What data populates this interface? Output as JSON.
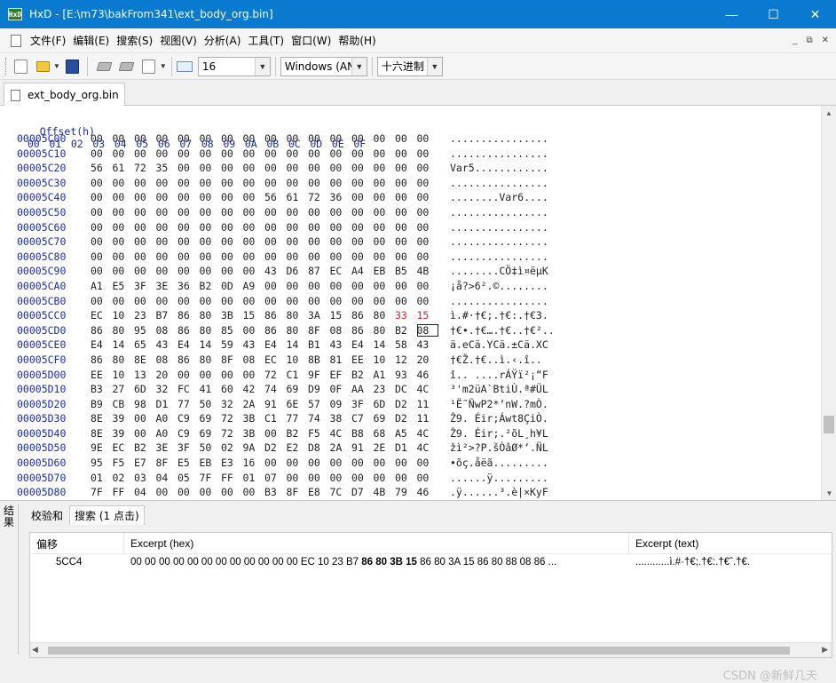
{
  "window": {
    "app_icon_text": "HxD",
    "title": "HxD - [E:\\m73\\bakFrom341\\ext_body_org.bin]",
    "minimize": "—",
    "maximize": "☐",
    "close": "✕"
  },
  "menu": {
    "items": [
      "文件(F)",
      "编辑(E)",
      "搜索(S)",
      "视图(V)",
      "分析(A)",
      "工具(T)",
      "窗口(W)",
      "帮助(H)"
    ],
    "mdi": [
      "_",
      "⧉",
      "✕"
    ]
  },
  "toolbar": {
    "bytes_per_row": "16",
    "charset": "Windows (ANSI)",
    "offset_base": "十六进制"
  },
  "file_tab": {
    "label": "ext_body_org.bin"
  },
  "hex": {
    "header_offset": "Offset(h)",
    "header_cols": [
      "00",
      "01",
      "02",
      "03",
      "04",
      "05",
      "06",
      "07",
      "08",
      "09",
      "0A",
      "0B",
      "0C",
      "0D",
      "0E",
      "0F"
    ],
    "rows": [
      {
        "offset": "00005C00",
        "bytes": [
          "00",
          "00",
          "00",
          "00",
          "00",
          "00",
          "00",
          "00",
          "00",
          "00",
          "00",
          "00",
          "00",
          "00",
          "00",
          "00"
        ],
        "text": "................"
      },
      {
        "offset": "00005C10",
        "bytes": [
          "00",
          "00",
          "00",
          "00",
          "00",
          "00",
          "00",
          "00",
          "00",
          "00",
          "00",
          "00",
          "00",
          "00",
          "00",
          "00"
        ],
        "text": "................"
      },
      {
        "offset": "00005C20",
        "bytes": [
          "56",
          "61",
          "72",
          "35",
          "00",
          "00",
          "00",
          "00",
          "00",
          "00",
          "00",
          "00",
          "00",
          "00",
          "00",
          "00"
        ],
        "text": "Var5............"
      },
      {
        "offset": "00005C30",
        "bytes": [
          "00",
          "00",
          "00",
          "00",
          "00",
          "00",
          "00",
          "00",
          "00",
          "00",
          "00",
          "00",
          "00",
          "00",
          "00",
          "00"
        ],
        "text": "................"
      },
      {
        "offset": "00005C40",
        "bytes": [
          "00",
          "00",
          "00",
          "00",
          "00",
          "00",
          "00",
          "00",
          "56",
          "61",
          "72",
          "36",
          "00",
          "00",
          "00",
          "00"
        ],
        "text": "........Var6...."
      },
      {
        "offset": "00005C50",
        "bytes": [
          "00",
          "00",
          "00",
          "00",
          "00",
          "00",
          "00",
          "00",
          "00",
          "00",
          "00",
          "00",
          "00",
          "00",
          "00",
          "00"
        ],
        "text": "................"
      },
      {
        "offset": "00005C60",
        "bytes": [
          "00",
          "00",
          "00",
          "00",
          "00",
          "00",
          "00",
          "00",
          "00",
          "00",
          "00",
          "00",
          "00",
          "00",
          "00",
          "00"
        ],
        "text": "................"
      },
      {
        "offset": "00005C70",
        "bytes": [
          "00",
          "00",
          "00",
          "00",
          "00",
          "00",
          "00",
          "00",
          "00",
          "00",
          "00",
          "00",
          "00",
          "00",
          "00",
          "00"
        ],
        "text": "................"
      },
      {
        "offset": "00005C80",
        "bytes": [
          "00",
          "00",
          "00",
          "00",
          "00",
          "00",
          "00",
          "00",
          "00",
          "00",
          "00",
          "00",
          "00",
          "00",
          "00",
          "00"
        ],
        "text": "................"
      },
      {
        "offset": "00005C90",
        "bytes": [
          "00",
          "00",
          "00",
          "00",
          "00",
          "00",
          "00",
          "00",
          "43",
          "D6",
          "87",
          "EC",
          "A4",
          "EB",
          "B5",
          "4B"
        ],
        "text": "........CÖ‡ì¤ëµK"
      },
      {
        "offset": "00005CA0",
        "bytes": [
          "A1",
          "E5",
          "3F",
          "3E",
          "36",
          "B2",
          "0D",
          "A9",
          "00",
          "00",
          "00",
          "00",
          "00",
          "00",
          "00",
          "00"
        ],
        "text": "¡å?>6².©........"
      },
      {
        "offset": "00005CB0",
        "bytes": [
          "00",
          "00",
          "00",
          "00",
          "00",
          "00",
          "00",
          "00",
          "00",
          "00",
          "00",
          "00",
          "00",
          "00",
          "00",
          "00"
        ],
        "text": "................"
      },
      {
        "offset": "00005CC0",
        "bytes": [
          "EC",
          "10",
          "23",
          "B7",
          "86",
          "80",
          "3B",
          "15",
          "86",
          "80",
          "3A",
          "15",
          "86",
          "80",
          "33",
          "15"
        ],
        "text": "ì.#·†€;.†€:.†€3."
      },
      {
        "offset": "00005CD0",
        "bytes": [
          "86",
          "80",
          "95",
          "08",
          "86",
          "80",
          "85",
          "00",
          "86",
          "80",
          "8F",
          "08",
          "86",
          "80",
          "B2",
          "08"
        ],
        "text": "†€•.†€….†€..†€².."
      },
      {
        "offset": "00005CE0",
        "bytes": [
          "E4",
          "14",
          "65",
          "43",
          "E4",
          "14",
          "59",
          "43",
          "E4",
          "14",
          "B1",
          "43",
          "E4",
          "14",
          "58",
          "43"
        ],
        "text": "ä.eCä.YCä.±Cä.XC"
      },
      {
        "offset": "00005CF0",
        "bytes": [
          "86",
          "80",
          "8E",
          "08",
          "86",
          "80",
          "8F",
          "08",
          "EC",
          "10",
          "8B",
          "81",
          "EE",
          "10",
          "12",
          "20"
        ],
        "text": "†€Ž.†€..ì.‹.î.. "
      },
      {
        "offset": "00005D00",
        "bytes": [
          "EE",
          "10",
          "13",
          "20",
          "00",
          "00",
          "00",
          "00",
          "72",
          "C1",
          "9F",
          "EF",
          "B2",
          "A1",
          "93",
          "46"
        ],
        "text": "î.. ....rÁŸï²¡“F"
      },
      {
        "offset": "00005D10",
        "bytes": [
          "B3",
          "27",
          "6D",
          "32",
          "FC",
          "41",
          "60",
          "42",
          "74",
          "69",
          "D9",
          "0F",
          "AA",
          "23",
          "DC",
          "4C"
        ],
        "text": "³'m2üA`BtiÙ.ª#ÜL"
      },
      {
        "offset": "00005D20",
        "bytes": [
          "B9",
          "CB",
          "98",
          "D1",
          "77",
          "50",
          "32",
          "2A",
          "91",
          "6E",
          "57",
          "09",
          "3F",
          "6D",
          "D2",
          "11"
        ],
        "text": "¹Ë˜ÑwP2*‘nW.?mÒ."
      },
      {
        "offset": "00005D30",
        "bytes": [
          "8E",
          "39",
          "00",
          "A0",
          "C9",
          "69",
          "72",
          "3B",
          "C1",
          "77",
          "74",
          "38",
          "C7",
          "69",
          "D2",
          "11"
        ],
        "text": "Ž9. Éir;Áwt8ÇiÒ."
      },
      {
        "offset": "00005D40",
        "bytes": [
          "8E",
          "39",
          "00",
          "A0",
          "C9",
          "69",
          "72",
          "3B",
          "00",
          "B2",
          "F5",
          "4C",
          "B8",
          "68",
          "A5",
          "4C"
        ],
        "text": "Ž9. Éir;.²õL¸h¥L"
      },
      {
        "offset": "00005D50",
        "bytes": [
          "9E",
          "EC",
          "B2",
          "3E",
          "3F",
          "50",
          "02",
          "9A",
          "D2",
          "E2",
          "D8",
          "2A",
          "91",
          "2E",
          "D1",
          "4C"
        ],
        "text": "žì²>?P.šÒâØ*‘.ÑL"
      },
      {
        "offset": "00005D60",
        "bytes": [
          "95",
          "F5",
          "E7",
          "8F",
          "E5",
          "EB",
          "E3",
          "16",
          "00",
          "00",
          "00",
          "00",
          "00",
          "00",
          "00",
          "00"
        ],
        "text": "•õç.åëã........."
      },
      {
        "offset": "00005D70",
        "bytes": [
          "01",
          "02",
          "03",
          "04",
          "05",
          "7F",
          "FF",
          "01",
          "07",
          "00",
          "00",
          "00",
          "00",
          "00",
          "00",
          "00"
        ],
        "text": "......ÿ........."
      },
      {
        "offset": "00005D80",
        "bytes": [
          "7F",
          "FF",
          "04",
          "00",
          "00",
          "00",
          "00",
          "00",
          "B3",
          "8F",
          "E8",
          "7C",
          "D7",
          "4B",
          "79",
          "46"
        ],
        "text": ".ÿ......³.è|×KyF"
      }
    ]
  },
  "bottom": {
    "side_label": "结果",
    "tabs": [
      "校验和",
      "搜索 (1 点击)"
    ],
    "columns": [
      "偏移",
      "Excerpt (hex)",
      "Excerpt (text)"
    ],
    "result": {
      "offset": "5CC4",
      "hex_pre": "00 00 00 00 00 00 00 00 00 00 00 00 EC 10 23 B7 ",
      "hex_match": "86 80 3B 15",
      "hex_post": " 86 80 3A 15 86 80 88 08 86 ...",
      "text": "............ì.#·†€;.†€:.†€ˆ.†€."
    }
  },
  "watermark": "CSDN @新鲜几天"
}
